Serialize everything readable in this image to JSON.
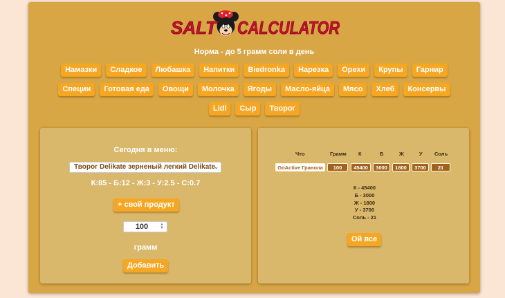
{
  "app": {
    "logo_text_left": "SALT",
    "logo_text_right": "CALCULATOR",
    "norm_text": "Норма - до 5 грамм соли в день"
  },
  "categories": {
    "rows": [
      [
        "Намазки",
        "Сладкое",
        "Любашка",
        "Напитки",
        "Biedronka",
        "Нарезка",
        "Орехи",
        "Крупы",
        "Гарнир"
      ],
      [
        "Специи",
        "Готовая еда",
        "Овощи",
        "Молочка",
        "Ягоды",
        "Масло-яйца",
        "Мясо",
        "Хлеб",
        "Консервы"
      ],
      [
        "Lidl",
        "Сыр",
        "Творог"
      ]
    ]
  },
  "left_panel": {
    "today_label": "Сегодня в меню:",
    "product_selected": "Творог Delikate зерненый легкий Delikate",
    "macros": "К:85 - Б:12 - Ж:3 - У:2.5 - С:0.7",
    "add_own_button": "+ свой продукт",
    "quantity_value": "100",
    "unit_label": "грамм",
    "add_button": "Добавить"
  },
  "right_panel": {
    "headers": [
      "Что",
      "Грамм",
      "К",
      "Б",
      "Ж",
      "У",
      "Соль"
    ],
    "row": [
      "GoActive Гранола",
      "100",
      "45400",
      "3000",
      "1800",
      "3700",
      "21"
    ],
    "totals": {
      "k": "К - 45400",
      "b": "Б - 3000",
      "zh": "Ж - 1800",
      "u": "У - 3700",
      "salt": "Соль - 21"
    },
    "all_button": "Ой все"
  },
  "colors": {
    "page_bg": "#fbe5d4",
    "app_bg": "#d9a645",
    "panel_bg": "#d9b86c",
    "button": "#f5a623",
    "cell": "#a0621e",
    "logo_red": "#c8102e"
  },
  "icons": {
    "logo_character": "mouse-with-polka-dot-bow-icon",
    "select_arrow": "chevron-down-icon",
    "spinner": "spinner-arrows-icon"
  }
}
